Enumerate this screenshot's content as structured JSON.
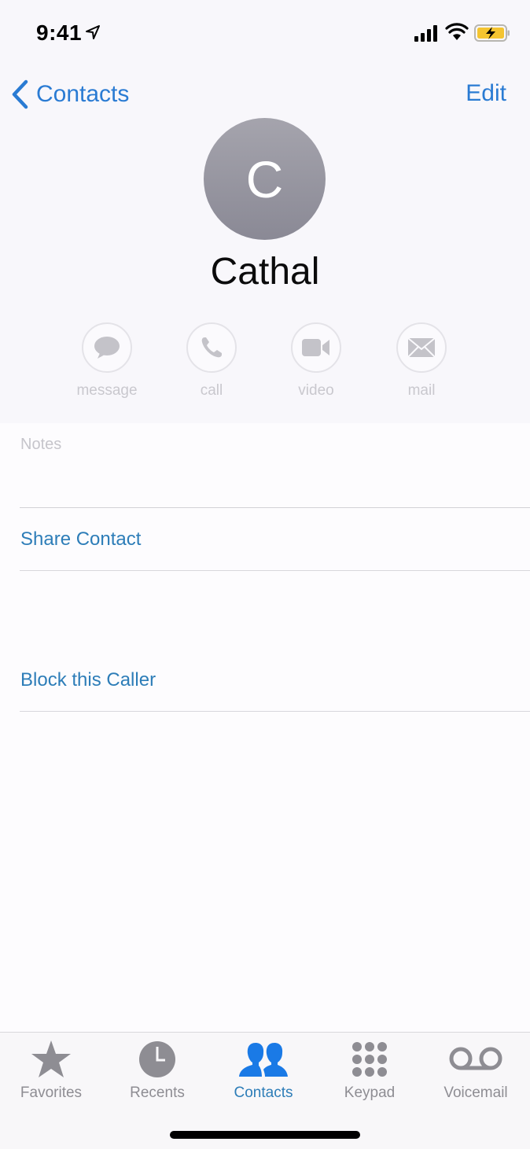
{
  "status_bar": {
    "time": "9:41",
    "icons": [
      "location-arrow-icon",
      "cellular-signal-icon",
      "wifi-icon",
      "battery-charging-icon"
    ]
  },
  "nav": {
    "back_label": "Contacts",
    "edit_label": "Edit"
  },
  "contact": {
    "initial": "C",
    "name": "Cathal"
  },
  "actions": [
    {
      "label": "message",
      "icon": "message-bubble-icon"
    },
    {
      "label": "call",
      "icon": "phone-icon"
    },
    {
      "label": "video",
      "icon": "video-camera-icon"
    },
    {
      "label": "mail",
      "icon": "envelope-icon"
    }
  ],
  "list": {
    "notes_label": "Notes",
    "share_contact": "Share Contact",
    "block_caller": "Block this Caller"
  },
  "tabbar": {
    "tabs": [
      {
        "label": "Favorites",
        "icon": "star-icon",
        "active": false
      },
      {
        "label": "Recents",
        "icon": "clock-icon",
        "active": false
      },
      {
        "label": "Contacts",
        "icon": "contacts-people-icon",
        "active": true
      },
      {
        "label": "Keypad",
        "icon": "keypad-icon",
        "active": false
      },
      {
        "label": "Voicemail",
        "icon": "voicemail-icon",
        "active": false
      }
    ]
  },
  "colors": {
    "accent": "#2a7bd3",
    "link": "#2d7db8",
    "inactive": "#8e8d93",
    "battery": "#f4c430"
  }
}
